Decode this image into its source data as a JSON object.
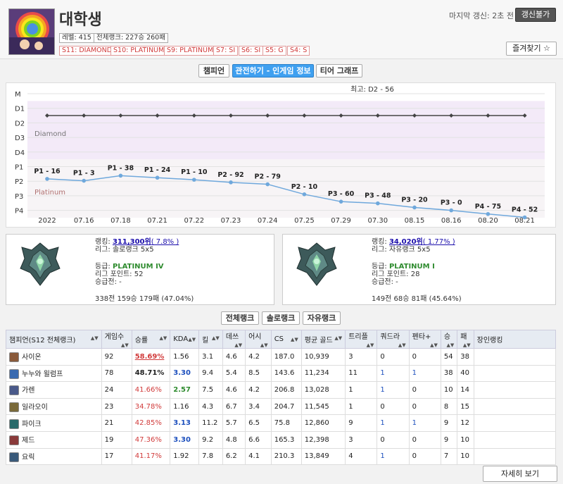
{
  "profile": {
    "name": "대학생",
    "level": "레벨: 415",
    "overall_rank": "전체랭크: 227승 260패",
    "seasons": [
      "S11: DIAMOND",
      "S10: PLATINUM",
      "S9: PLATINUM",
      "S7: SI",
      "S6: SI",
      "S5: G",
      "S4: S"
    ],
    "last_update": "마지막 갱신: 2초 전",
    "update_button": "갱신불가",
    "favorite_button": "즐겨찾기 ☆"
  },
  "tabs": [
    "챔피언",
    "관전하기 - 인게임 정보",
    "티어 그래프"
  ],
  "chart_data": {
    "type": "line",
    "title": "최고: D2 - 56",
    "y_labels": [
      "M",
      "D1",
      "D2",
      "D3",
      "D4",
      "P1",
      "P2",
      "P3",
      "P4"
    ],
    "bands": [
      "Diamond",
      "Platinum"
    ],
    "x": [
      "2022",
      "07.16",
      "07.18",
      "07.21",
      "07.22",
      "07.23",
      "07.24",
      "07.25",
      "07.29",
      "07.30",
      "08.15",
      "08.16",
      "08.20",
      "08.21"
    ],
    "series": [
      {
        "values_tier_index": [
          1.5,
          1.5,
          1.5,
          1.5,
          1.5,
          1.5,
          1.5,
          1.5,
          1.5,
          1.5,
          1.5,
          1.5,
          1.5,
          1.5
        ]
      },
      {
        "labels": [
          "P1 - 16",
          "P1 - 3",
          "P1 - 38",
          "P1 - 24",
          "P1 - 10",
          "P2 - 92",
          "P2 - 79",
          "P2 - 10",
          "P3 - 60",
          "P3 - 48",
          "P3 - 20",
          "P3 - 0",
          "P4 - 75",
          "P4 - 52"
        ],
        "values_tier_index": [
          5.84,
          5.97,
          5.62,
          5.76,
          5.9,
          6.08,
          6.21,
          6.9,
          7.4,
          7.52,
          7.8,
          8.0,
          8.25,
          8.48
        ]
      }
    ],
    "colors": {
      "diamond_band": "#f3eaf8",
      "platinum_band": "#f7f4f6",
      "line1": "#444444",
      "line2": "#6fa8dc"
    }
  },
  "solo": {
    "ranking_label": "랭킹: ",
    "ranking": "311,300위",
    "ranking_pct": "( 7.8% )",
    "league": "리그: 솔로랭크 5x5",
    "grade_label": "등급: ",
    "grade": "PLATINUM IV",
    "lp": "리그 포인트: 52",
    "promo": "승급전: -",
    "record": "338전 159승 179패 (47.04%)"
  },
  "flex": {
    "ranking_label": "랭킹: ",
    "ranking": "34,020위",
    "ranking_pct": "( 1.77% )",
    "league": "리그: 자유랭크 5x5",
    "grade_label": "등급: ",
    "grade": "PLATINUM I",
    "lp": "리그 포인트: 28",
    "promo": "승급전: -",
    "record": "149전 68승 81패 (45.64%)"
  },
  "rank_tabs": [
    "전체랭크",
    "솔로랭크",
    "자유랭크"
  ],
  "table": {
    "headers": [
      "챔피언(S12 전체랭크)",
      "게임수",
      "승률",
      "KDA",
      "킬",
      "데쓰",
      "어시",
      "CS",
      "평균 골드",
      "트리플",
      "쿼드라",
      "펜타+",
      "승",
      "패",
      "장인랭킹"
    ],
    "rows": [
      {
        "champ": "사이온",
        "color": "#8a5a3a",
        "games": "92",
        "winrate": "58.69%",
        "wr_class": "red-u",
        "kda": "1.56",
        "kda_class": "",
        "k": "3.1",
        "d": "4.6",
        "a": "4.2",
        "cs": "187.0",
        "gold": "10,939",
        "triple": "3",
        "quadra": "0",
        "penta": "0",
        "w": "54",
        "l": "38"
      },
      {
        "champ": "누누와 윌럼프",
        "color": "#3a6ab0",
        "games": "78",
        "winrate": "48.71%",
        "wr_class": "bold",
        "kda": "3.30",
        "kda_class": "blue",
        "k": "9.4",
        "d": "5.4",
        "a": "8.5",
        "cs": "143.6",
        "gold": "11,234",
        "triple": "11",
        "quadra": "1",
        "penta": "1",
        "w": "38",
        "l": "40"
      },
      {
        "champ": "가렌",
        "color": "#4a5a8a",
        "games": "24",
        "winrate": "41.66%",
        "wr_class": "red",
        "kda": "2.57",
        "kda_class": "green",
        "k": "7.5",
        "d": "4.6",
        "a": "4.2",
        "cs": "206.8",
        "gold": "13,028",
        "triple": "1",
        "quadra": "1",
        "penta": "0",
        "w": "10",
        "l": "14"
      },
      {
        "champ": "일라오이",
        "color": "#7a6a3a",
        "games": "23",
        "winrate": "34.78%",
        "wr_class": "red",
        "kda": "1.16",
        "kda_class": "",
        "k": "4.3",
        "d": "6.7",
        "a": "3.4",
        "cs": "204.7",
        "gold": "11,545",
        "triple": "1",
        "quadra": "0",
        "penta": "0",
        "w": "8",
        "l": "15"
      },
      {
        "champ": "파이크",
        "color": "#2a6a6a",
        "games": "21",
        "winrate": "42.85%",
        "wr_class": "red",
        "kda": "3.13",
        "kda_class": "blue",
        "k": "11.2",
        "d": "5.7",
        "a": "6.5",
        "cs": "75.8",
        "gold": "12,860",
        "triple": "9",
        "quadra": "1",
        "penta": "1",
        "w": "9",
        "l": "12"
      },
      {
        "champ": "제드",
        "color": "#8a3a3a",
        "games": "19",
        "winrate": "47.36%",
        "wr_class": "red",
        "kda": "3.30",
        "kda_class": "blue",
        "k": "9.2",
        "d": "4.8",
        "a": "6.6",
        "cs": "165.3",
        "gold": "12,398",
        "triple": "3",
        "quadra": "0",
        "penta": "0",
        "w": "9",
        "l": "10"
      },
      {
        "champ": "요릭",
        "color": "#3a5a7a",
        "games": "17",
        "winrate": "41.17%",
        "wr_class": "red",
        "kda": "1.92",
        "kda_class": "",
        "k": "7.8",
        "d": "6.2",
        "a": "4.1",
        "cs": "210.3",
        "gold": "13,849",
        "triple": "4",
        "quadra": "1",
        "penta": "0",
        "w": "7",
        "l": "10"
      }
    ]
  },
  "detail_button": "자세히 보기"
}
